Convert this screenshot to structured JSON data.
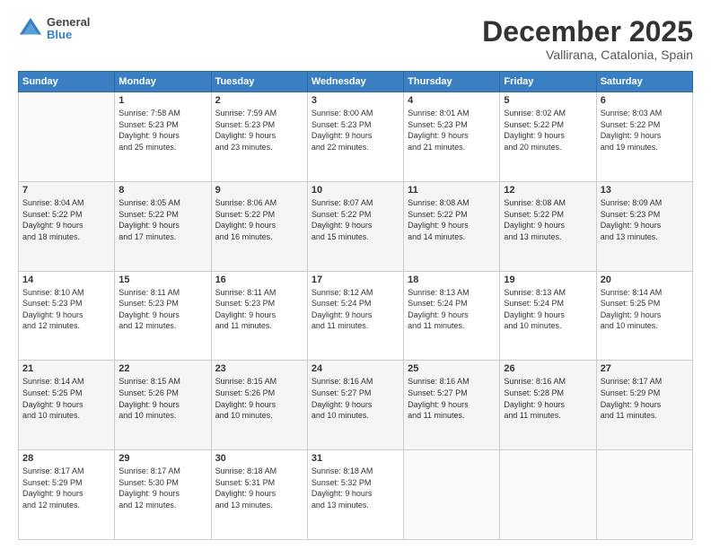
{
  "logo": {
    "line1": "General",
    "line2": "Blue"
  },
  "header": {
    "title": "December 2025",
    "subtitle": "Vallirana, Catalonia, Spain"
  },
  "weekdays": [
    "Sunday",
    "Monday",
    "Tuesday",
    "Wednesday",
    "Thursday",
    "Friday",
    "Saturday"
  ],
  "weeks": [
    [
      {
        "day": "",
        "info": ""
      },
      {
        "day": "1",
        "info": "Sunrise: 7:58 AM\nSunset: 5:23 PM\nDaylight: 9 hours\nand 25 minutes."
      },
      {
        "day": "2",
        "info": "Sunrise: 7:59 AM\nSunset: 5:23 PM\nDaylight: 9 hours\nand 23 minutes."
      },
      {
        "day": "3",
        "info": "Sunrise: 8:00 AM\nSunset: 5:23 PM\nDaylight: 9 hours\nand 22 minutes."
      },
      {
        "day": "4",
        "info": "Sunrise: 8:01 AM\nSunset: 5:23 PM\nDaylight: 9 hours\nand 21 minutes."
      },
      {
        "day": "5",
        "info": "Sunrise: 8:02 AM\nSunset: 5:22 PM\nDaylight: 9 hours\nand 20 minutes."
      },
      {
        "day": "6",
        "info": "Sunrise: 8:03 AM\nSunset: 5:22 PM\nDaylight: 9 hours\nand 19 minutes."
      }
    ],
    [
      {
        "day": "7",
        "info": "Sunrise: 8:04 AM\nSunset: 5:22 PM\nDaylight: 9 hours\nand 18 minutes."
      },
      {
        "day": "8",
        "info": "Sunrise: 8:05 AM\nSunset: 5:22 PM\nDaylight: 9 hours\nand 17 minutes."
      },
      {
        "day": "9",
        "info": "Sunrise: 8:06 AM\nSunset: 5:22 PM\nDaylight: 9 hours\nand 16 minutes."
      },
      {
        "day": "10",
        "info": "Sunrise: 8:07 AM\nSunset: 5:22 PM\nDaylight: 9 hours\nand 15 minutes."
      },
      {
        "day": "11",
        "info": "Sunrise: 8:08 AM\nSunset: 5:22 PM\nDaylight: 9 hours\nand 14 minutes."
      },
      {
        "day": "12",
        "info": "Sunrise: 8:08 AM\nSunset: 5:22 PM\nDaylight: 9 hours\nand 13 minutes."
      },
      {
        "day": "13",
        "info": "Sunrise: 8:09 AM\nSunset: 5:23 PM\nDaylight: 9 hours\nand 13 minutes."
      }
    ],
    [
      {
        "day": "14",
        "info": "Sunrise: 8:10 AM\nSunset: 5:23 PM\nDaylight: 9 hours\nand 12 minutes."
      },
      {
        "day": "15",
        "info": "Sunrise: 8:11 AM\nSunset: 5:23 PM\nDaylight: 9 hours\nand 12 minutes."
      },
      {
        "day": "16",
        "info": "Sunrise: 8:11 AM\nSunset: 5:23 PM\nDaylight: 9 hours\nand 11 minutes."
      },
      {
        "day": "17",
        "info": "Sunrise: 8:12 AM\nSunset: 5:24 PM\nDaylight: 9 hours\nand 11 minutes."
      },
      {
        "day": "18",
        "info": "Sunrise: 8:13 AM\nSunset: 5:24 PM\nDaylight: 9 hours\nand 11 minutes."
      },
      {
        "day": "19",
        "info": "Sunrise: 8:13 AM\nSunset: 5:24 PM\nDaylight: 9 hours\nand 10 minutes."
      },
      {
        "day": "20",
        "info": "Sunrise: 8:14 AM\nSunset: 5:25 PM\nDaylight: 9 hours\nand 10 minutes."
      }
    ],
    [
      {
        "day": "21",
        "info": "Sunrise: 8:14 AM\nSunset: 5:25 PM\nDaylight: 9 hours\nand 10 minutes."
      },
      {
        "day": "22",
        "info": "Sunrise: 8:15 AM\nSunset: 5:26 PM\nDaylight: 9 hours\nand 10 minutes."
      },
      {
        "day": "23",
        "info": "Sunrise: 8:15 AM\nSunset: 5:26 PM\nDaylight: 9 hours\nand 10 minutes."
      },
      {
        "day": "24",
        "info": "Sunrise: 8:16 AM\nSunset: 5:27 PM\nDaylight: 9 hours\nand 10 minutes."
      },
      {
        "day": "25",
        "info": "Sunrise: 8:16 AM\nSunset: 5:27 PM\nDaylight: 9 hours\nand 11 minutes."
      },
      {
        "day": "26",
        "info": "Sunrise: 8:16 AM\nSunset: 5:28 PM\nDaylight: 9 hours\nand 11 minutes."
      },
      {
        "day": "27",
        "info": "Sunrise: 8:17 AM\nSunset: 5:29 PM\nDaylight: 9 hours\nand 11 minutes."
      }
    ],
    [
      {
        "day": "28",
        "info": "Sunrise: 8:17 AM\nSunset: 5:29 PM\nDaylight: 9 hours\nand 12 minutes."
      },
      {
        "day": "29",
        "info": "Sunrise: 8:17 AM\nSunset: 5:30 PM\nDaylight: 9 hours\nand 12 minutes."
      },
      {
        "day": "30",
        "info": "Sunrise: 8:18 AM\nSunset: 5:31 PM\nDaylight: 9 hours\nand 13 minutes."
      },
      {
        "day": "31",
        "info": "Sunrise: 8:18 AM\nSunset: 5:32 PM\nDaylight: 9 hours\nand 13 minutes."
      },
      {
        "day": "",
        "info": ""
      },
      {
        "day": "",
        "info": ""
      },
      {
        "day": "",
        "info": ""
      }
    ]
  ]
}
